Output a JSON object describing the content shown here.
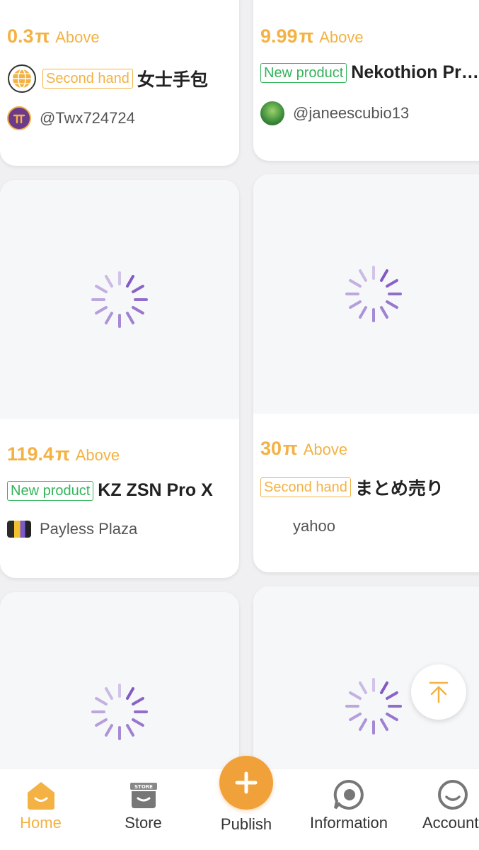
{
  "currency_symbol": "π",
  "above_label": "Above",
  "cards": [
    {
      "price": "0.3",
      "tag": "Second hand",
      "title": "女士手包",
      "seller": "@Twx724724"
    },
    {
      "price": "9.99",
      "tag": "New product",
      "title": "Nekothion Pro Max",
      "seller": "@janeescubio13"
    },
    {
      "price": "119.4",
      "tag": "New product",
      "title": "KZ ZSN Pro X",
      "seller": "Payless Plaza"
    },
    {
      "price": "30",
      "tag": "Second hand",
      "title": "まとめ売り",
      "seller": "yahoo"
    }
  ],
  "tabs": {
    "home": "Home",
    "store": "Store",
    "publish": "Publish",
    "information": "Information",
    "account": "Account"
  },
  "colors": {
    "accent": "#f3b243",
    "new_tag": "#33b45a",
    "spinner": "#7b4fc0",
    "publish": "#f0a13a"
  }
}
